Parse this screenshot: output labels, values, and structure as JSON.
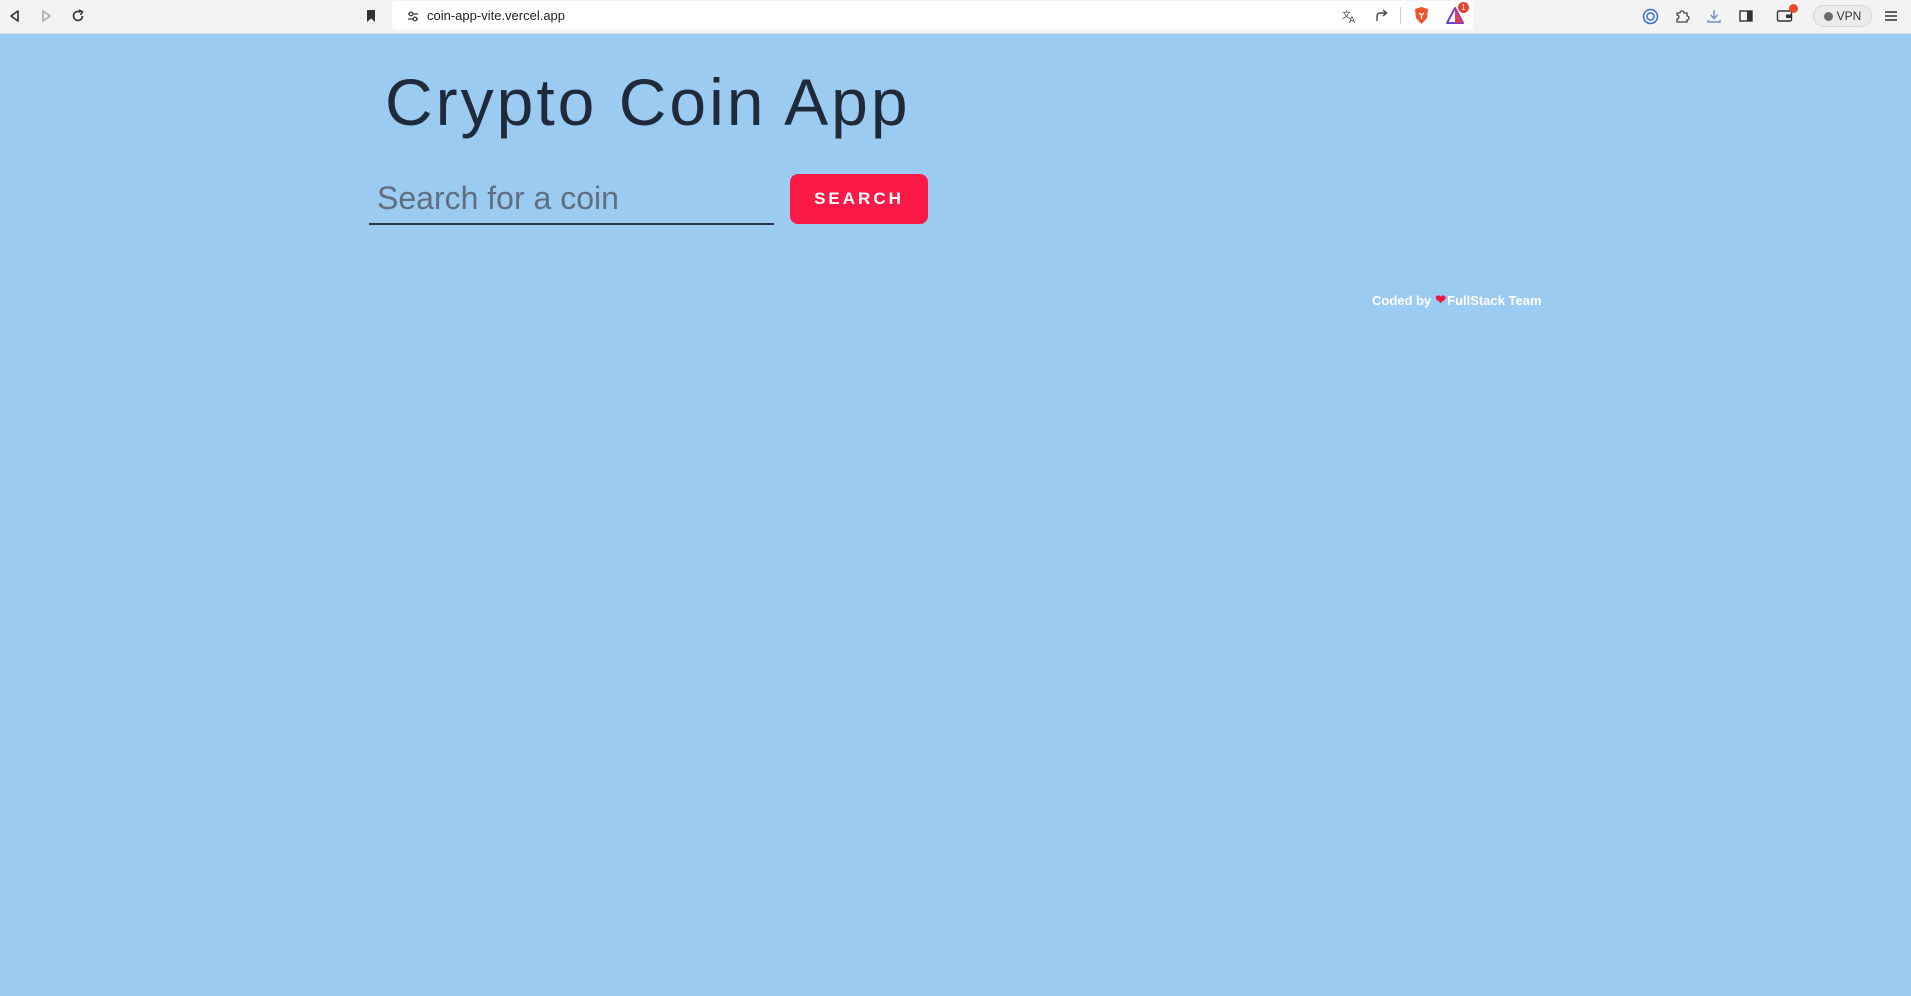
{
  "browser": {
    "url": "coin-app-vite.vercel.app",
    "vpn_label": "VPN",
    "alerts_badge": "1",
    "icons": [
      "back-icon",
      "forward-icon",
      "reload-icon",
      "bookmark-icon",
      "site-settings-icon",
      "translate-icon",
      "share-icon",
      "brave-shields-icon",
      "brave-rewards-icon",
      "brave-wallet-icon",
      "extensions-icon",
      "downloads-icon",
      "sidebar-icon",
      "wallet-icon",
      "menu-icon"
    ]
  },
  "page": {
    "title": "Crypto Coin App",
    "search": {
      "placeholder": "Search for a coin",
      "value": ""
    },
    "search_button": "SEARCH",
    "credit": {
      "prefix": "Coded by",
      "heart": "❤",
      "team": "FullStack Team"
    }
  },
  "colors": {
    "background": "#9ccbf2",
    "button": "#fb1a47",
    "title": "#1f2a3a",
    "heart": "#f01844"
  }
}
